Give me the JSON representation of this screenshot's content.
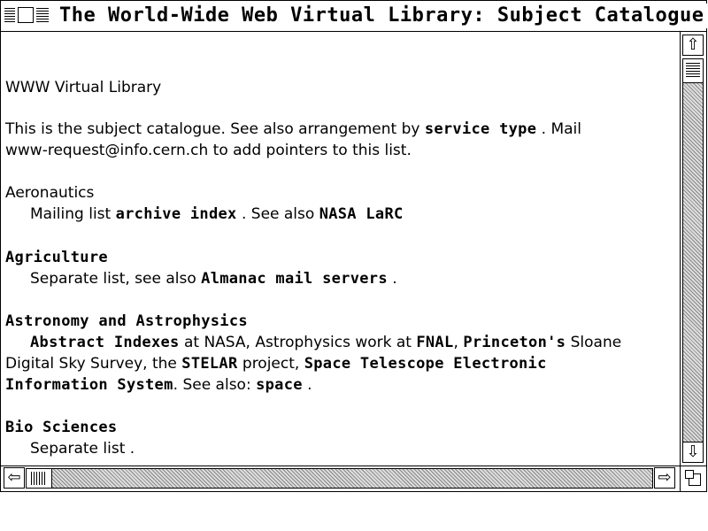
{
  "window": {
    "title": "The World-Wide Web Virtual Library: Subject Catalogue"
  },
  "page": {
    "heading": "WWW Virtual Library",
    "intro_line1": {
      "text1": "This is the subject catalogue. See also arrangement  by ",
      "link1": "service type",
      "text2": " . Mail"
    },
    "intro_line2": "www-request@info.cern.ch to add pointers to this list.",
    "sections": {
      "aeronautics": {
        "title": "Aeronautics",
        "text1": "Mailing list ",
        "link1": "archive index",
        "text2": " . See also ",
        "link2": "NASA LaRC"
      },
      "agriculture": {
        "title": "Agriculture",
        "text1": "Separate list, see also ",
        "link1": "Almanac mail servers",
        "text2": " ."
      },
      "astronomy": {
        "title": "Astronomy and Astrophysics",
        "link1": "Abstract Indexes",
        "text1": " at NASA,  Astrophysics work at ",
        "link2": "FNAL",
        "text2": ", ",
        "link3": "Princeton's",
        "text3": " Sloane",
        "text4": "Digital Sky Survey, the ",
        "link4": "STELAR",
        "text5": " project, ",
        "link5": "Space Telescope  Electronic",
        "link6": "Information System",
        "text6": ". See also: ",
        "link7": "space",
        "text7": " ."
      },
      "bio": {
        "title": "Bio Sciences",
        "text1": "Separate list",
        "text2": " ."
      }
    }
  },
  "icons": {
    "scroll_up": "⇧",
    "scroll_down": "⇩",
    "scroll_left": "⇦",
    "scroll_right": "⇨"
  }
}
